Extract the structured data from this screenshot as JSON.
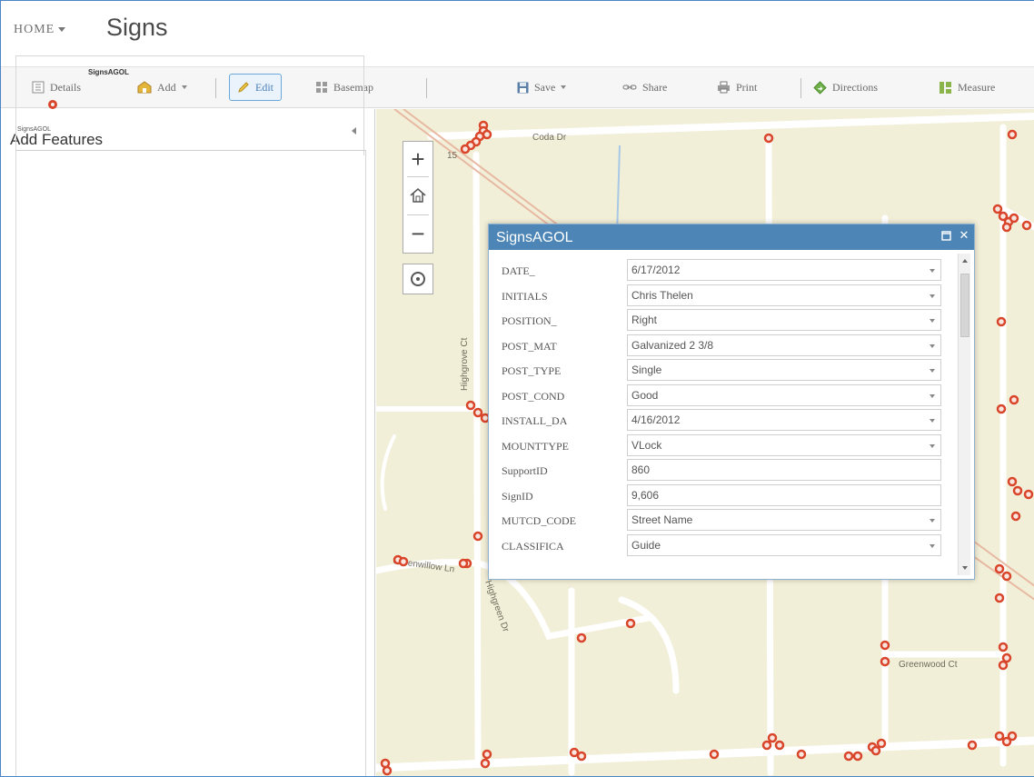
{
  "header": {
    "home_label": "HOME",
    "title": "Signs"
  },
  "toolbar": {
    "details": "Details",
    "add": "Add",
    "edit": "Edit",
    "basemap": "Basemap",
    "save": "Save",
    "share": "Share",
    "print": "Print",
    "directions": "Directions",
    "measure": "Measure"
  },
  "panel": {
    "title": "Add Features",
    "template_header": "SignsAGOL",
    "template_label": "SignsAGOL"
  },
  "map": {
    "zoom_in": "+",
    "zoom_out": "−",
    "street_labels": {
      "coda": "Coda Dr",
      "highgrove": "Highgrove Ct",
      "greenwillow": "Greenwillow Ln",
      "greenwood": "Greenwood Ct",
      "highgreen": "Highgreen Dr",
      "route": "15"
    },
    "colors": {
      "background": "#f2efd8",
      "road": "#ffffff",
      "marker": "#d9452a"
    }
  },
  "popup": {
    "title": "SignsAGOL",
    "fields": [
      {
        "label": "DATE_",
        "value": "6/17/2012",
        "dropdown": true
      },
      {
        "label": "INITIALS",
        "value": "Chris Thelen",
        "dropdown": true
      },
      {
        "label": "POSITION_",
        "value": "Right",
        "dropdown": true
      },
      {
        "label": "POST_MAT",
        "value": "Galvanized 2 3/8",
        "dropdown": true
      },
      {
        "label": "POST_TYPE",
        "value": "Single",
        "dropdown": true
      },
      {
        "label": "POST_COND",
        "value": "Good",
        "dropdown": true
      },
      {
        "label": "INSTALL_DA",
        "value": "4/16/2012",
        "dropdown": true
      },
      {
        "label": "MOUNTTYPE",
        "value": "VLock",
        "dropdown": true
      },
      {
        "label": "SupportID",
        "value": "860",
        "dropdown": false
      },
      {
        "label": "SignID",
        "value": "9,606",
        "dropdown": false
      },
      {
        "label": "MUTCD_CODE",
        "value": "Street Name",
        "dropdown": true
      },
      {
        "label": "CLASSIFICA",
        "value": "Guide",
        "dropdown": true
      }
    ]
  }
}
